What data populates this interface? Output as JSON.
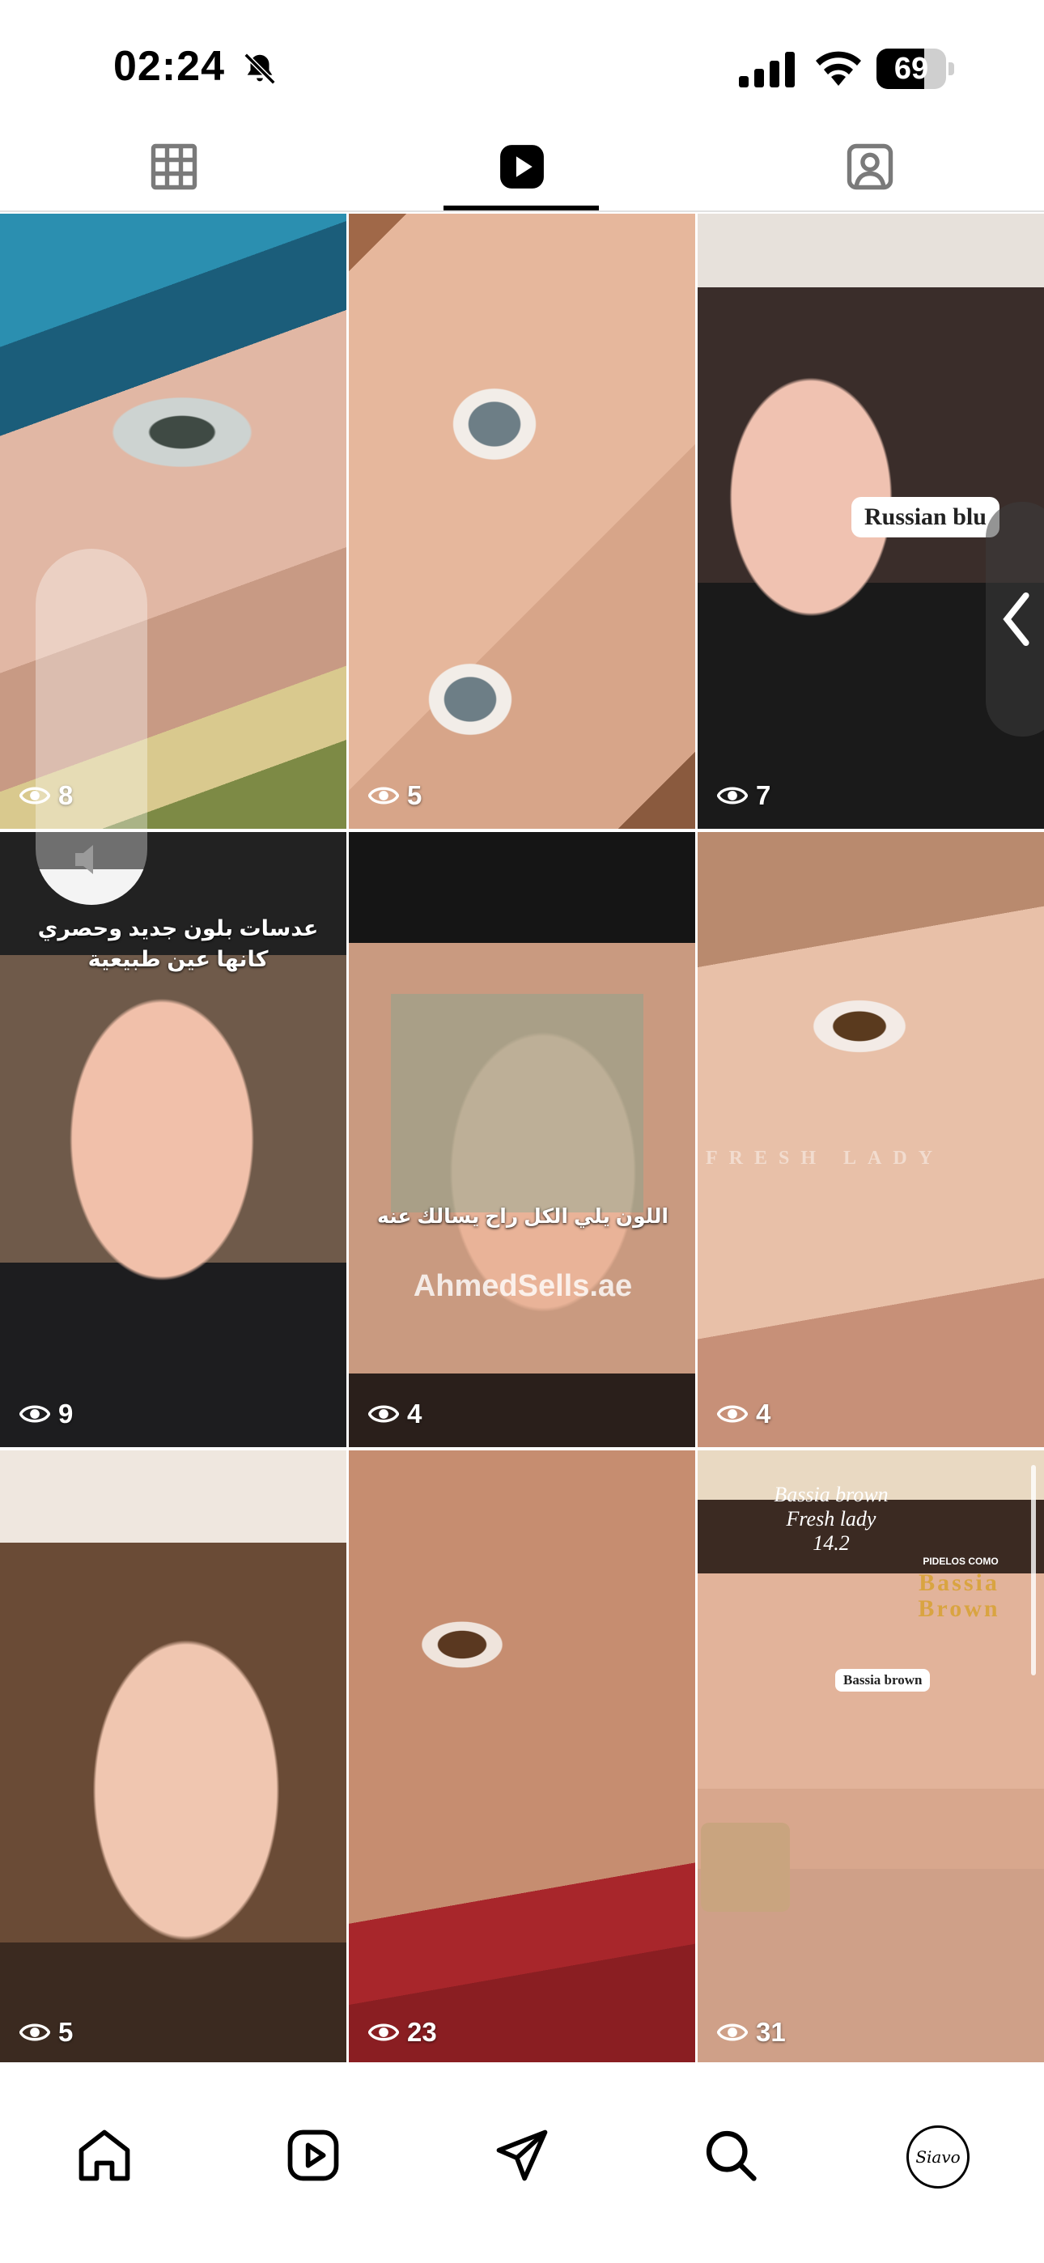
{
  "status_bar": {
    "time": "02:24",
    "battery": "69",
    "battery_level": 0.69
  },
  "tabs": [
    {
      "name": "grid",
      "icon": "grid-icon",
      "active": false
    },
    {
      "name": "reels",
      "icon": "reels-icon",
      "active": true
    },
    {
      "name": "tagged",
      "icon": "tagged-icon",
      "active": false
    }
  ],
  "grid": {
    "tiles": [
      {
        "views": "8"
      },
      {
        "views": "5"
      },
      {
        "views": "7",
        "chip": "Russian blu"
      },
      {
        "views": "9",
        "overlay_line1": "عدسات بلون جديد وحصري",
        "overlay_line2": "كانها عين طبيعية"
      },
      {
        "views": "4",
        "overlay": "اللون يلي الكل راح يسالك عنه",
        "watermark": "AhmedSells.ae"
      },
      {
        "views": "4",
        "watermark": "FRESH LADY"
      },
      {
        "views": "5"
      },
      {
        "views": "23"
      },
      {
        "views": "31",
        "line1": "Bassia brown",
        "line2": "Fresh lady",
        "line3": "14.2",
        "small": "PIDELOS COMO",
        "brand_line1": "Bassia",
        "brand_line2": "Brown",
        "chip": "Bassia brown"
      }
    ]
  },
  "volume": {
    "level": 0.1,
    "icon": "speaker-icon"
  },
  "bottom_nav": {
    "items": [
      {
        "icon": "home-icon"
      },
      {
        "icon": "reels-icon"
      },
      {
        "icon": "send-icon"
      },
      {
        "icon": "search-icon"
      }
    ],
    "avatar_text": "Siavo"
  }
}
